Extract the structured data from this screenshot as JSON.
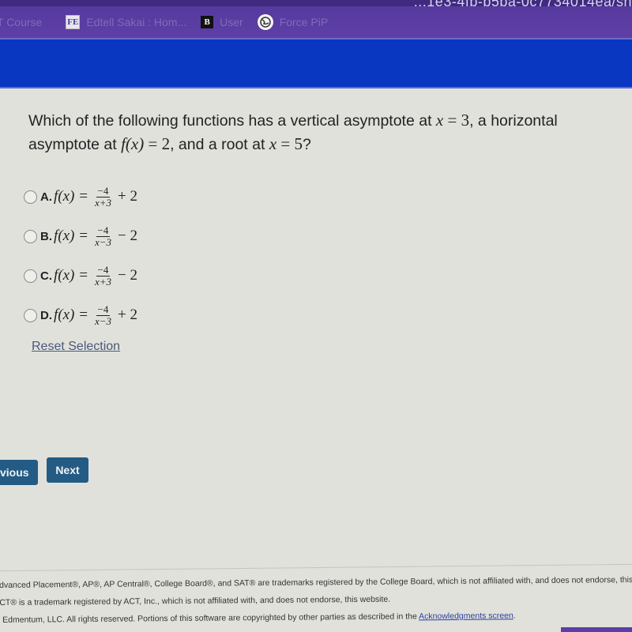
{
  "browser": {
    "url_fragment": "...1e3-4fb-b5ba-0c7734014ea/sh",
    "bookmarks": [
      {
        "label": "T Course",
        "icon": "none"
      },
      {
        "label": "Edtell Sakai : Hom...",
        "icon": "FE"
      },
      {
        "label": "User",
        "icon": "B"
      },
      {
        "label": "Force PiP",
        "icon": "pip-globe"
      }
    ]
  },
  "question": {
    "text_part1": "Which of the following functions has a vertical asymptote at ",
    "var_x": "x",
    "eq": " = ",
    "val_3": "3",
    "text_part2": ", a horizontal asymptote at ",
    "fx": "f(x)",
    "val_2": "2",
    "text_part3": ", and a root at ",
    "val_5": "5",
    "q_mark": "?"
  },
  "options": [
    {
      "letter": "A.",
      "lhs": "f(x) =",
      "numerator": "−4",
      "denominator": "x+3",
      "tail": "+ 2",
      "selected": false
    },
    {
      "letter": "B.",
      "lhs": "f(x) =",
      "numerator": "−4",
      "denominator": "x−3",
      "tail": "− 2",
      "selected": false
    },
    {
      "letter": "C.",
      "lhs": "f(x) =",
      "numerator": "−4",
      "denominator": "x+3",
      "tail": "− 2",
      "selected": false
    },
    {
      "letter": "D.",
      "lhs": "f(x) =",
      "numerator": "−4",
      "denominator": "x−3",
      "tail": "+ 2",
      "selected": false
    }
  ],
  "reset_label": "Reset Selection",
  "nav": {
    "previous_label": "Previous",
    "next_label": "Next"
  },
  "footer": {
    "line1": "Advanced Placement®, AP®, AP Central®, College Board®, and SAT® are trademarks registered by the College Board, which is not affiliated with, and does not endorse, this website.",
    "line2": "ACT® is a trademark registered by ACT, Inc., which is not affiliated with, and does not endorse, this website.",
    "line3_prefix": "© Edmentum, LLC. All rights reserved. Portions of this software are copyrighted by other parties as described in the ",
    "line3_link": "Acknowledgments screen",
    "line3_suffix": "."
  },
  "colors": {
    "bookmarks_bar": "#573a9e",
    "header_blue": "#0a37c2",
    "button_blue": "#235b85",
    "page_bg": "#e1e1dc"
  }
}
